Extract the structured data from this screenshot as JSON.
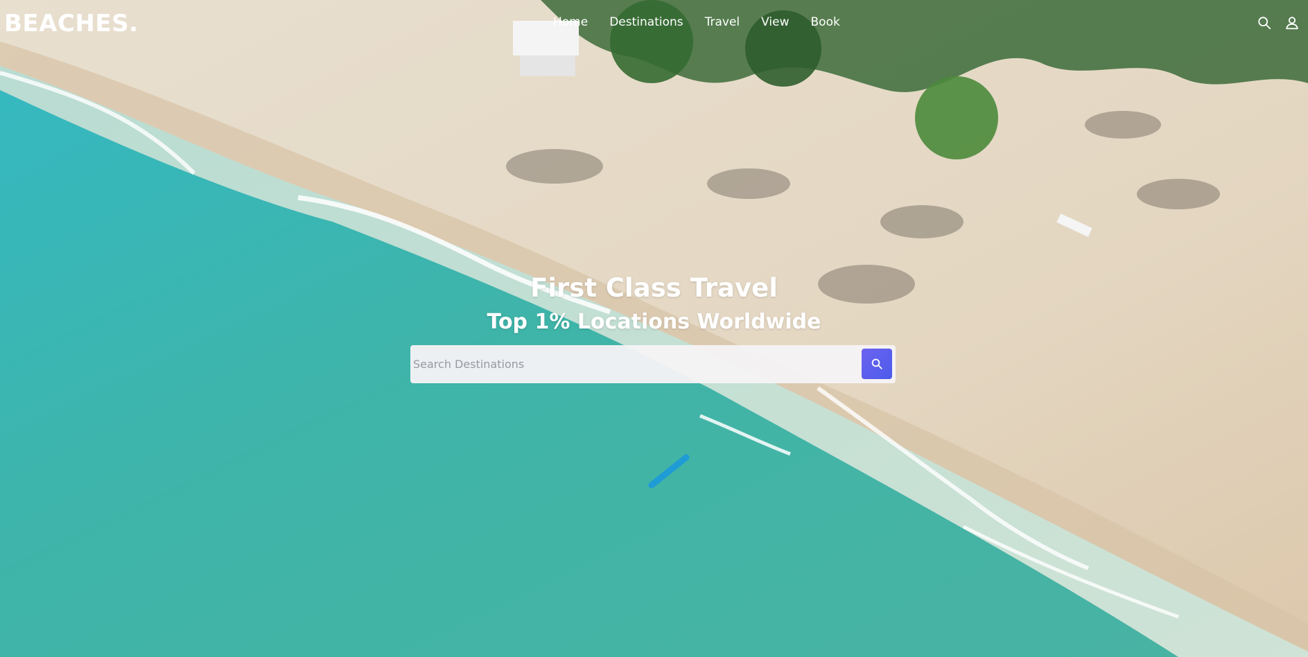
{
  "brand": {
    "logo": "BEACHES."
  },
  "nav": {
    "links": [
      "Home",
      "Destinations",
      "Travel",
      "View",
      "Book"
    ],
    "icons": [
      "search-icon",
      "user-icon"
    ]
  },
  "hero": {
    "title": "First Class Travel",
    "subtitle": "Top 1% Locations Worldwide"
  },
  "search": {
    "placeholder": "Search Destinations",
    "button_icon": "search-icon"
  },
  "colors": {
    "accent": "#5b5fef",
    "text_on_image": "#ffffff",
    "ocean": "#3fb3ad",
    "sand": "#e7ddcc"
  }
}
